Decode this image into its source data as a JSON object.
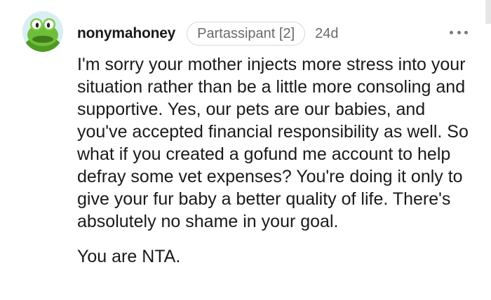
{
  "comment": {
    "author": "nonymahoney",
    "flair": "Partassipant [2]",
    "age": "24d",
    "avatar_icon": "kermit-frog-avatar",
    "more_icon": "more-options-icon",
    "body_paragraphs": [
      "I'm sorry your mother injects more stress into your situation rather than be a little more consoling and supportive. Yes, our pets are our babies, and you've accepted financial responsibility as well. So what if you created a gofund me account to help defray some vet expenses? You're doing it only to give your fur baby a better quality of life. There's absolutely no shame in your goal.",
      "You are NTA."
    ]
  },
  "colors": {
    "text": "#1a1a1b",
    "muted": "#6a6a6a",
    "flair_border": "#d7d7d7",
    "avatar_green": "#5fae2e"
  }
}
